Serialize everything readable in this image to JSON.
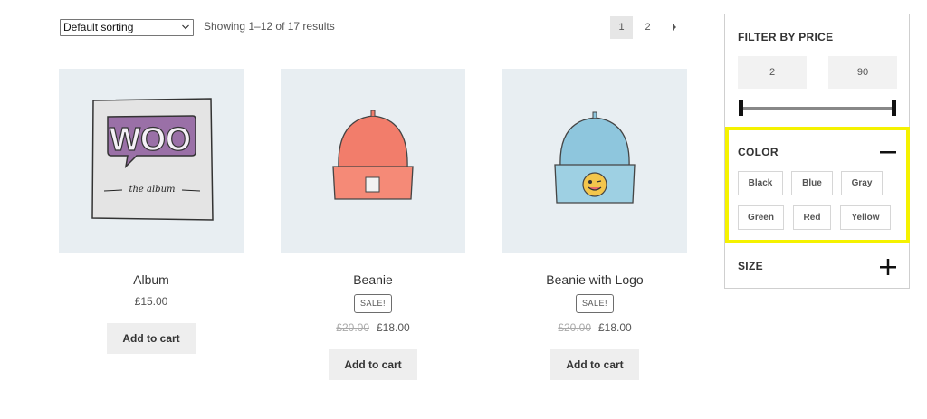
{
  "toolbar": {
    "sort_value": "Default sorting",
    "result_count": "Showing 1–12 of 17 results",
    "pages": [
      "1",
      "2"
    ],
    "current_page": "1"
  },
  "products": [
    {
      "title": "Album",
      "price": "£15.00",
      "sale": false,
      "button": "Add to cart",
      "image_text": "WOO",
      "image_caption": "the album"
    },
    {
      "title": "Beanie",
      "badge": "SALE!",
      "old_price": "£20.00",
      "price": "£18.00",
      "sale": true,
      "button": "Add to cart"
    },
    {
      "title": "Beanie with Logo",
      "badge": "SALE!",
      "old_price": "£20.00",
      "price": "£18.00",
      "sale": true,
      "button": "Add to cart"
    }
  ],
  "sidebar": {
    "price_filter": {
      "heading": "FILTER BY PRICE",
      "min": "2",
      "max": "90"
    },
    "color_filter": {
      "heading": "COLOR",
      "options": [
        "Black",
        "Blue",
        "Gray",
        "Green",
        "Red",
        "Yellow"
      ],
      "expanded": true
    },
    "size_filter": {
      "heading": "SIZE",
      "expanded": false
    }
  },
  "colors": {
    "highlight": "#f5f200",
    "thumb_bg": "#e8eef2",
    "button_bg": "#eeeeee"
  }
}
